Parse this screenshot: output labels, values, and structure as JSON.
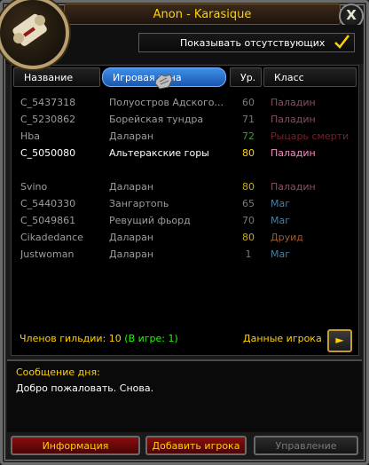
{
  "window": {
    "title": "Anon - Karasique",
    "close_glyph": "X"
  },
  "header": {
    "show_offline_label": "Показывать отсутствующих",
    "show_offline_checked": true
  },
  "columns": [
    {
      "label": "Название"
    },
    {
      "label": "Игровая зона"
    },
    {
      "label": "Ур."
    },
    {
      "label": "Класс"
    }
  ],
  "members": [
    {
      "name": "C_5437318",
      "zone": "Полуостров Адского...",
      "level": "60",
      "class": "Паладин",
      "online": false,
      "class_color": "#83515e",
      "level_color": "#7a7a7a"
    },
    {
      "name": "C_5230862",
      "zone": "Борейская тундра",
      "level": "71",
      "class": "Паладин",
      "online": false,
      "class_color": "#83515e",
      "level_color": "#7a7a7a"
    },
    {
      "name": "Hba",
      "zone": "Даларан",
      "level": "72",
      "class": "Рыцарь смерти",
      "online": false,
      "class_color": "#7a1f2a",
      "level_color": "#3e9c2a"
    },
    {
      "name": "C_5050080",
      "zone": "Альтеракские горы",
      "level": "80",
      "class": "Паладин",
      "online": true,
      "class_color": "#f58cba",
      "level_color": "#ffd100"
    },
    {
      "name": "",
      "zone": "",
      "level": "",
      "class": "",
      "online": false,
      "class_color": "#000000",
      "level_color": "#000000"
    },
    {
      "name": "Svino",
      "zone": "Даларан",
      "level": "80",
      "class": "Паладин",
      "online": false,
      "class_color": "#83515e",
      "level_color": "#c9a81f"
    },
    {
      "name": "C_5440330",
      "zone": "Зангартопь",
      "level": "65",
      "class": "Маг",
      "online": false,
      "class_color": "#4a7fa0",
      "level_color": "#7a7a7a"
    },
    {
      "name": "C_5049861",
      "zone": "Ревущий фьорд",
      "level": "70",
      "class": "Маг",
      "online": false,
      "class_color": "#4a7fa0",
      "level_color": "#7a7a7a"
    },
    {
      "name": "Cikadedance",
      "zone": "Даларан",
      "level": "80",
      "class": "Друид",
      "online": false,
      "class_color": "#a0592a",
      "level_color": "#c9a81f"
    },
    {
      "name": "Justwoman",
      "zone": "Даларан",
      "level": "1",
      "class": "Маг",
      "online": false,
      "class_color": "#4a7fa0",
      "level_color": "#7a7a7a"
    }
  ],
  "footer": {
    "members_label": "Членов гильдии:",
    "members_count": "10",
    "online_label": "(В игре: 1)",
    "player_info_label": "Данные игрока",
    "player_info_glyph": "►"
  },
  "motd": {
    "title": "Сообщение дня:",
    "text": "Добро пожаловать. Снова."
  },
  "buttons": {
    "info": "Информация",
    "add_player": "Добавить игрока",
    "control": "Управление"
  },
  "colors": {
    "gold": "#ffd100",
    "online_green": "#1eff00",
    "active_tab": "#2f7bd8"
  },
  "icons": {
    "portrait": "guild-scroll-icon",
    "checkmark": "checkmark-icon",
    "cursor": "gauntlet-cursor-icon"
  }
}
